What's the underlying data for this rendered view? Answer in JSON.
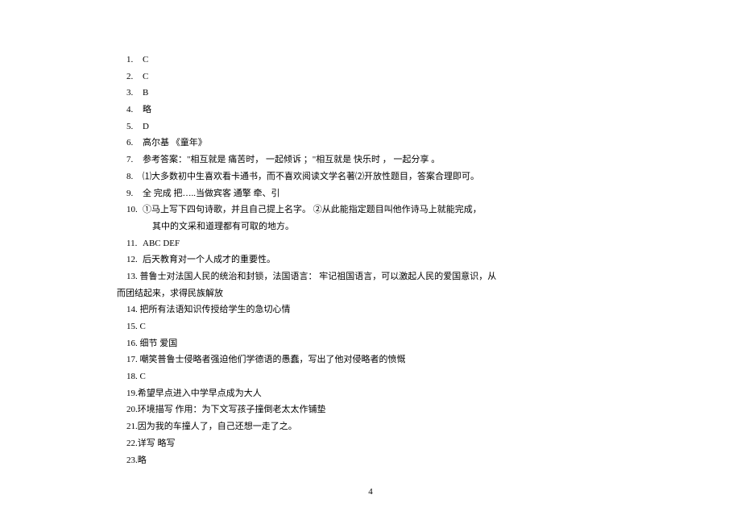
{
  "lines": [
    {
      "num": "1.",
      "text": "C",
      "indent": true
    },
    {
      "num": "2.",
      "text": "C",
      "indent": true
    },
    {
      "num": "3.",
      "text": "B",
      "indent": true
    },
    {
      "num": "4.",
      "text": "略",
      "indent": true
    },
    {
      "num": "5.",
      "text": "D",
      "indent": true
    },
    {
      "num": "6.",
      "text": "高尔基  《童年》",
      "indent": true
    },
    {
      "num": "7.",
      "text": "参考答案：\"相互就是  痛苦时，    一起倾诉    ；\"相互就是  快乐时  ，    一起分享  。",
      "indent": true
    },
    {
      "num": "8.",
      "text": "⑴大多数初中生喜欢看卡通书，而不喜欢阅读文学名著⑵开放性题目，答案合理即可。",
      "indent": true
    },
    {
      "num": "9.",
      "text": "全    完成      把…..当做宾客      通擎    牵、引",
      "indent": true
    },
    {
      "num": "10.",
      "text": "①马上写下四句诗歌，并且自己提上名字。          ②从此能指定题目叫他作诗马上就能完成，",
      "indent": true
    },
    {
      "num": "",
      "text": "其中的文采和道理都有可取的地方。",
      "sub": true
    },
    {
      "num": "11.",
      "text": "ABC          DEF",
      "indent": true
    },
    {
      "num": "12.",
      "text": "后天教育对一个人成才的重要性。",
      "indent": true
    },
    {
      "num": "",
      "text": "13. 普鲁士对法国人民的统治和封锁，法国语言：    牢记祖国语言，可以激起人民的爱国意识，从",
      "indent13": true
    },
    {
      "num": "",
      "text": "而团结起来，求得民族解放",
      "flat": true
    },
    {
      "num": "",
      "text": "14. 把所有法语知识传授给学生的急切心情",
      "indent13": true
    },
    {
      "num": "",
      "text": "15. C",
      "indent13": true
    },
    {
      "num": "",
      "text": "16. 细节   爱国",
      "indent13": true
    },
    {
      "num": "",
      "text": "17. 嘲笑普鲁士侵略者强迫他们学德语的愚蠢，写出了他对侵略者的愤慨",
      "indent13": true
    },
    {
      "num": "",
      "text": "18. C",
      "indent13": true
    },
    {
      "num": "",
      "text": "19.希望早点进入中学早点成为大人",
      "indent13": true
    },
    {
      "num": "",
      "text": "20.环境描写    作用：为下文写孩子撞倒老太太作铺垫",
      "indent13": true
    },
    {
      "num": "",
      "text": "21.因为我的车撞人了，自己还想一走了之。",
      "indent13": true
    },
    {
      "num": "",
      "text": "22.详写   略写",
      "indent13": true
    },
    {
      "num": "",
      "text": "23.略",
      "indent13": true
    }
  ],
  "page_number": "4"
}
